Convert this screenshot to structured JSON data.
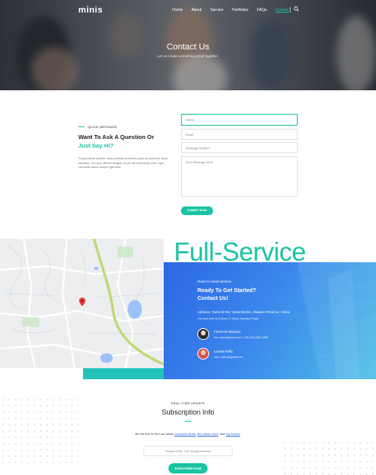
{
  "nav": {
    "logo": "minis",
    "items": [
      "Home",
      "About",
      "Service",
      "Portfolios",
      "FAQs",
      "Contact"
    ],
    "active": "Contact"
  },
  "hero": {
    "title": "Contact Us",
    "subtitle": "Let us create something great together."
  },
  "contact": {
    "tag": "QUICK MESSAGE",
    "heading": "Want To Ask A Question Or",
    "heading_accent": "Just Say Hi?",
    "paragraph": "Suspendisse potenti. Nam porttitor pharetra quam ac placerat. Nam faucibus, orci sed ultrices feugiat, turpis nisl sollicitudin erat, eget convallis metus neque eget sem."
  },
  "form": {
    "name_placeholder": "Name",
    "email_placeholder": "Email",
    "subject_placeholder": "Message Subject",
    "message_placeholder": "Your Message Here",
    "submit_label": "SUBMIT NOW"
  },
  "service": {
    "title": "Full-Service",
    "tag": "Heart to heart service",
    "heading_line1": "Ready To Get Started?",
    "heading_line2": "Contact Us!",
    "address": "Address: Yanta W Rd, Yanta District, Shaanxi Province, China",
    "hours": "Our work time is 8:30am-17:30pm, Monday-Friday.",
    "people": [
      {
        "name": "Florence Moreno",
        "contact": "em: sales@gmail.com / +86-115-4867-4891"
      },
      {
        "name": "Louisa Kelly",
        "contact": "ellor: sales@gmail.com"
      }
    ]
  },
  "subscribe": {
    "tag": "REAL-TIME UPDATE",
    "title": "Subscription Info",
    "text_prefix": "Be the first to find out about",
    "link1": "exclusive deals",
    "link2": "the latest news",
    "text_and": "and",
    "link3": "top trends",
    "input_placeholder": "Please Enter Your Email Address",
    "button_label": "SUBSCRIBE NOW"
  },
  "colors": {
    "accent": "#19c3a3",
    "blue": "#2d67e3"
  }
}
